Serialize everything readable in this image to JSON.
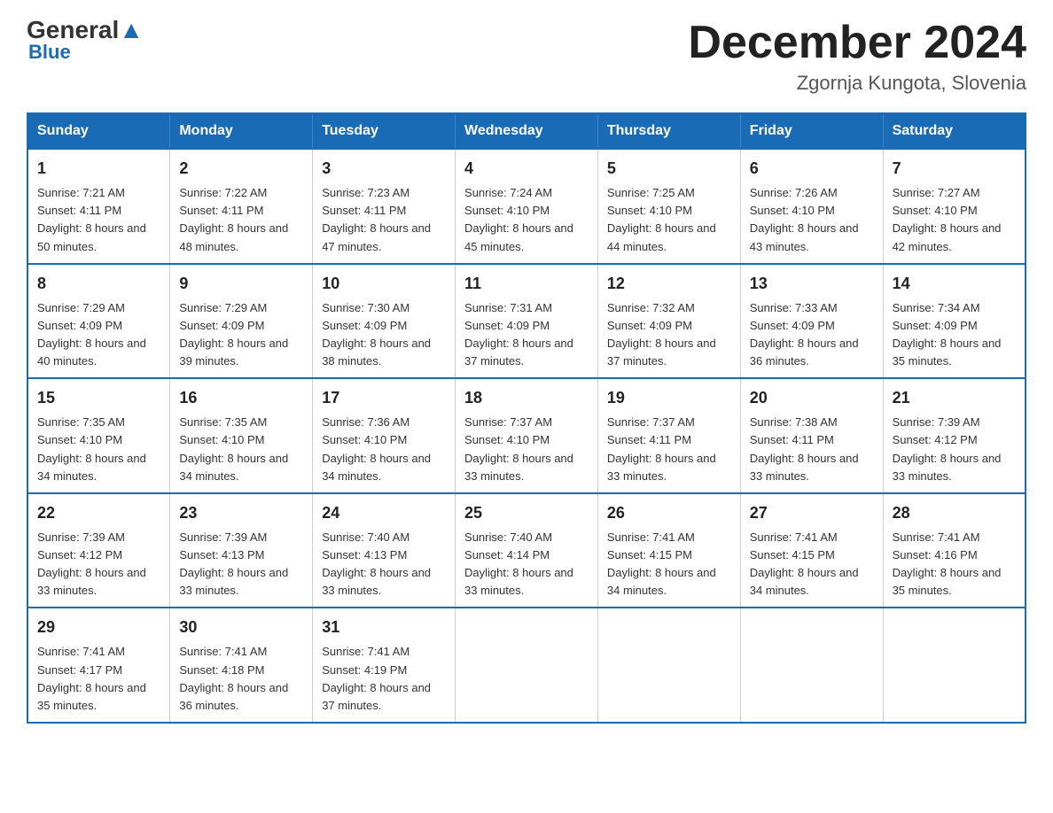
{
  "header": {
    "logo_general": "General",
    "logo_blue": "Blue",
    "title": "December 2024",
    "subtitle": "Zgornja Kungota, Slovenia"
  },
  "days_of_week": [
    "Sunday",
    "Monday",
    "Tuesday",
    "Wednesday",
    "Thursday",
    "Friday",
    "Saturday"
  ],
  "weeks": [
    [
      {
        "day": "1",
        "sunrise": "7:21 AM",
        "sunset": "4:11 PM",
        "daylight": "8 hours and 50 minutes."
      },
      {
        "day": "2",
        "sunrise": "7:22 AM",
        "sunset": "4:11 PM",
        "daylight": "8 hours and 48 minutes."
      },
      {
        "day": "3",
        "sunrise": "7:23 AM",
        "sunset": "4:11 PM",
        "daylight": "8 hours and 47 minutes."
      },
      {
        "day": "4",
        "sunrise": "7:24 AM",
        "sunset": "4:10 PM",
        "daylight": "8 hours and 45 minutes."
      },
      {
        "day": "5",
        "sunrise": "7:25 AM",
        "sunset": "4:10 PM",
        "daylight": "8 hours and 44 minutes."
      },
      {
        "day": "6",
        "sunrise": "7:26 AM",
        "sunset": "4:10 PM",
        "daylight": "8 hours and 43 minutes."
      },
      {
        "day": "7",
        "sunrise": "7:27 AM",
        "sunset": "4:10 PM",
        "daylight": "8 hours and 42 minutes."
      }
    ],
    [
      {
        "day": "8",
        "sunrise": "7:29 AM",
        "sunset": "4:09 PM",
        "daylight": "8 hours and 40 minutes."
      },
      {
        "day": "9",
        "sunrise": "7:29 AM",
        "sunset": "4:09 PM",
        "daylight": "8 hours and 39 minutes."
      },
      {
        "day": "10",
        "sunrise": "7:30 AM",
        "sunset": "4:09 PM",
        "daylight": "8 hours and 38 minutes."
      },
      {
        "day": "11",
        "sunrise": "7:31 AM",
        "sunset": "4:09 PM",
        "daylight": "8 hours and 37 minutes."
      },
      {
        "day": "12",
        "sunrise": "7:32 AM",
        "sunset": "4:09 PM",
        "daylight": "8 hours and 37 minutes."
      },
      {
        "day": "13",
        "sunrise": "7:33 AM",
        "sunset": "4:09 PM",
        "daylight": "8 hours and 36 minutes."
      },
      {
        "day": "14",
        "sunrise": "7:34 AM",
        "sunset": "4:09 PM",
        "daylight": "8 hours and 35 minutes."
      }
    ],
    [
      {
        "day": "15",
        "sunrise": "7:35 AM",
        "sunset": "4:10 PM",
        "daylight": "8 hours and 34 minutes."
      },
      {
        "day": "16",
        "sunrise": "7:35 AM",
        "sunset": "4:10 PM",
        "daylight": "8 hours and 34 minutes."
      },
      {
        "day": "17",
        "sunrise": "7:36 AM",
        "sunset": "4:10 PM",
        "daylight": "8 hours and 34 minutes."
      },
      {
        "day": "18",
        "sunrise": "7:37 AM",
        "sunset": "4:10 PM",
        "daylight": "8 hours and 33 minutes."
      },
      {
        "day": "19",
        "sunrise": "7:37 AM",
        "sunset": "4:11 PM",
        "daylight": "8 hours and 33 minutes."
      },
      {
        "day": "20",
        "sunrise": "7:38 AM",
        "sunset": "4:11 PM",
        "daylight": "8 hours and 33 minutes."
      },
      {
        "day": "21",
        "sunrise": "7:39 AM",
        "sunset": "4:12 PM",
        "daylight": "8 hours and 33 minutes."
      }
    ],
    [
      {
        "day": "22",
        "sunrise": "7:39 AM",
        "sunset": "4:12 PM",
        "daylight": "8 hours and 33 minutes."
      },
      {
        "day": "23",
        "sunrise": "7:39 AM",
        "sunset": "4:13 PM",
        "daylight": "8 hours and 33 minutes."
      },
      {
        "day": "24",
        "sunrise": "7:40 AM",
        "sunset": "4:13 PM",
        "daylight": "8 hours and 33 minutes."
      },
      {
        "day": "25",
        "sunrise": "7:40 AM",
        "sunset": "4:14 PM",
        "daylight": "8 hours and 33 minutes."
      },
      {
        "day": "26",
        "sunrise": "7:41 AM",
        "sunset": "4:15 PM",
        "daylight": "8 hours and 34 minutes."
      },
      {
        "day": "27",
        "sunrise": "7:41 AM",
        "sunset": "4:15 PM",
        "daylight": "8 hours and 34 minutes."
      },
      {
        "day": "28",
        "sunrise": "7:41 AM",
        "sunset": "4:16 PM",
        "daylight": "8 hours and 35 minutes."
      }
    ],
    [
      {
        "day": "29",
        "sunrise": "7:41 AM",
        "sunset": "4:17 PM",
        "daylight": "8 hours and 35 minutes."
      },
      {
        "day": "30",
        "sunrise": "7:41 AM",
        "sunset": "4:18 PM",
        "daylight": "8 hours and 36 minutes."
      },
      {
        "day": "31",
        "sunrise": "7:41 AM",
        "sunset": "4:19 PM",
        "daylight": "8 hours and 37 minutes."
      },
      null,
      null,
      null,
      null
    ]
  ]
}
